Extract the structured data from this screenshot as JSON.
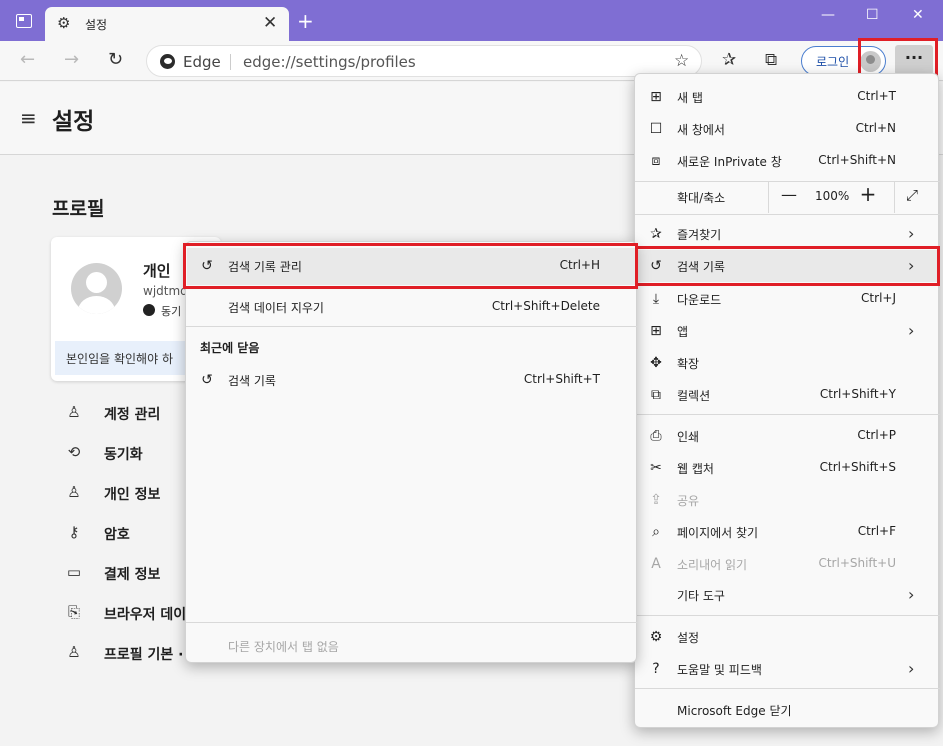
{
  "tab": {
    "title": "설정"
  },
  "address": {
    "site": "Edge",
    "url": "edge://settings/profiles"
  },
  "toolbar": {
    "login_label": "로그인",
    "more_label": "···"
  },
  "page": {
    "title": "설정",
    "section": "프로필",
    "profile": {
      "name": "개인",
      "email": "wjdtmd",
      "sync": "동기",
      "banner": "본인임을 확인해야 하"
    },
    "settings": [
      {
        "label": "계정 관리",
        "icon": "person-icon"
      },
      {
        "label": "동기화",
        "icon": "sync-icon"
      },
      {
        "label": "개인 정보",
        "icon": "personal-info-icon"
      },
      {
        "label": "암호",
        "icon": "key-icon"
      },
      {
        "label": "결제 정보",
        "icon": "card-icon"
      },
      {
        "label": "브라우저 데이",
        "icon": "import-icon"
      },
      {
        "label": "프로필 기본 ·",
        "icon": "profile-prefs-icon"
      }
    ]
  },
  "main_menu": {
    "new_tab": {
      "label": "새 탭",
      "shortcut": "Ctrl+T"
    },
    "new_window": {
      "label": "새 창에서",
      "shortcut": "Ctrl+N"
    },
    "inprivate": {
      "label": "새로운 InPrivate 창",
      "shortcut": "Ctrl+Shift+N"
    },
    "zoom": {
      "label": "확대/축소",
      "value": "100%"
    },
    "favorites": {
      "label": "즐겨찾기"
    },
    "history": {
      "label": "검색 기록"
    },
    "downloads": {
      "label": "다운로드",
      "shortcut": "Ctrl+J"
    },
    "apps": {
      "label": "앱"
    },
    "extensions": {
      "label": "확장"
    },
    "collections": {
      "label": "컬렉션",
      "shortcut": "Ctrl+Shift+Y"
    },
    "print": {
      "label": "인쇄",
      "shortcut": "Ctrl+P"
    },
    "web_capture": {
      "label": "웹 캡처",
      "shortcut": "Ctrl+Shift+S"
    },
    "share": {
      "label": "공유"
    },
    "find": {
      "label": "페이지에서 찾기",
      "shortcut": "Ctrl+F"
    },
    "read_aloud": {
      "label": "소리내어 읽기",
      "shortcut": "Ctrl+Shift+U"
    },
    "more_tools": {
      "label": "기타 도구"
    },
    "settings": {
      "label": "설정"
    },
    "help": {
      "label": "도움말 및 피드백"
    },
    "close_edge": {
      "label": "Microsoft Edge 닫기"
    }
  },
  "history_menu": {
    "manage": {
      "label": "검색 기록 관리",
      "shortcut": "Ctrl+H"
    },
    "clear": {
      "label": "검색 데이터 지우기",
      "shortcut": "Ctrl+Shift+Delete"
    },
    "recently_closed": "최근에 닫음",
    "history_item": {
      "label": "검색 기록",
      "shortcut": "Ctrl+Shift+T"
    },
    "other_devices": "다른 장치에서 탭 없음"
  }
}
